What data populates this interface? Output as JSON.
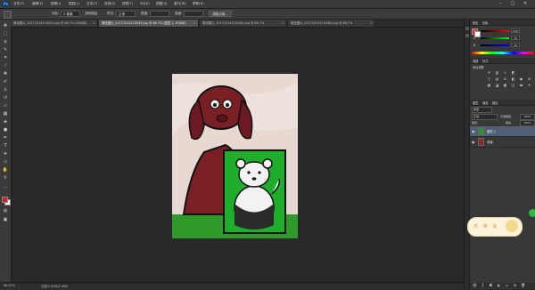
{
  "app": {
    "logo": "Ps"
  },
  "menubar": {
    "items": [
      "文件(F)",
      "编辑(E)",
      "图像(I)",
      "图层(L)",
      "文字(Y)",
      "选择(S)",
      "滤镜(T)",
      "3D(D)",
      "视图(V)",
      "窗口(W)",
      "帮助(H)"
    ]
  },
  "window_controls": {
    "minimize": "–",
    "maximize": "▢",
    "close": "✕"
  },
  "optionsbar": {
    "tool_icon": "marquee-tool-icon",
    "feather_label": "羽化:",
    "feather_value": "0 像素",
    "antialias_label": "消除锯齿",
    "style_label": "样式:",
    "style_value": "正常",
    "width_label": "宽度:",
    "height_label": "高度:",
    "refine_button": "调整边缘..."
  },
  "tabs": [
    {
      "label": "微信图片_20171014110051.jpg @ 66.7% (RGB/8)",
      "active": false
    },
    {
      "label": "微信图片_20171014110043.jpg @ 66.7% (图层 1, RGB/8)",
      "active": true
    },
    {
      "label": "微信图片_20171014110046.png @ 66.7%",
      "active": false
    },
    {
      "label": "微信图片_20171014110048.png @ 66.7%",
      "active": false
    }
  ],
  "statusbar": {
    "zoom": "66.67%",
    "doc_info": "文档:1.03M/2.06M"
  },
  "color_panel": {
    "tabs": [
      "颜色",
      "色板"
    ],
    "sliders": [
      {
        "label": "R",
        "value": "216",
        "gradient": "#ff0000"
      },
      {
        "label": "G",
        "value": "30",
        "gradient": "#00ff00"
      },
      {
        "label": "B",
        "value": "30",
        "gradient": "#0000ff"
      }
    ],
    "fg_color": "#d81e1e",
    "bg_color": "#ffffff"
  },
  "adjustments_panel": {
    "tabs": [
      "调整",
      "样式"
    ],
    "title": "添加调整",
    "icons": [
      "brightness-icon",
      "levels-icon",
      "curves-icon",
      "exposure-icon",
      "vibrance-icon",
      "hue-icon",
      "balance-icon",
      "bw-icon",
      "photo-filter-icon",
      "mixer-icon",
      "lookup-icon",
      "invert-icon",
      "posterize-icon",
      "threshold-icon",
      "gradient-map-icon",
      "selective-color-icon"
    ]
  },
  "layers_panel": {
    "tabs": [
      "图层",
      "通道",
      "路径"
    ],
    "kind_label": "类型",
    "blend_mode": "正常",
    "opacity_label": "不透明度:",
    "opacity_value": "100%",
    "lock_label": "锁定:",
    "fill_label": "填充:",
    "fill_value": "100%",
    "layers": [
      {
        "name": "图层 1",
        "selected": true,
        "thumb": "#3a8a3a"
      },
      {
        "name": "背景",
        "selected": false,
        "thumb": "#8c2a2a"
      }
    ]
  },
  "float_badge": {
    "text": "乐 简 谈"
  },
  "colors": {
    "dog": "#7a1f24",
    "grass": "#2f9a2a",
    "bear_bg": "#1fae2b",
    "bear": "#f2f2f2"
  }
}
